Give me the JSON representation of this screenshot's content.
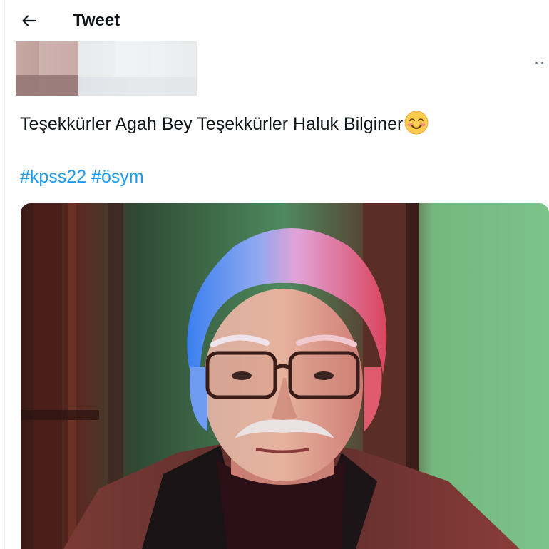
{
  "header": {
    "title": "Tweet"
  },
  "tweet": {
    "text": "Teşekkürler Agah Bey Teşekkürler Haluk Bilginer",
    "emoji": "smiling-face-with-smiling-eyes",
    "hashtags": [
      "#kpss22",
      "#ösym"
    ]
  },
  "icons": {
    "back": "arrow-left-icon",
    "more": "more-dots-icon"
  },
  "colors": {
    "link": "#1d9bf0",
    "text": "#0f1419",
    "muted": "#536471"
  }
}
